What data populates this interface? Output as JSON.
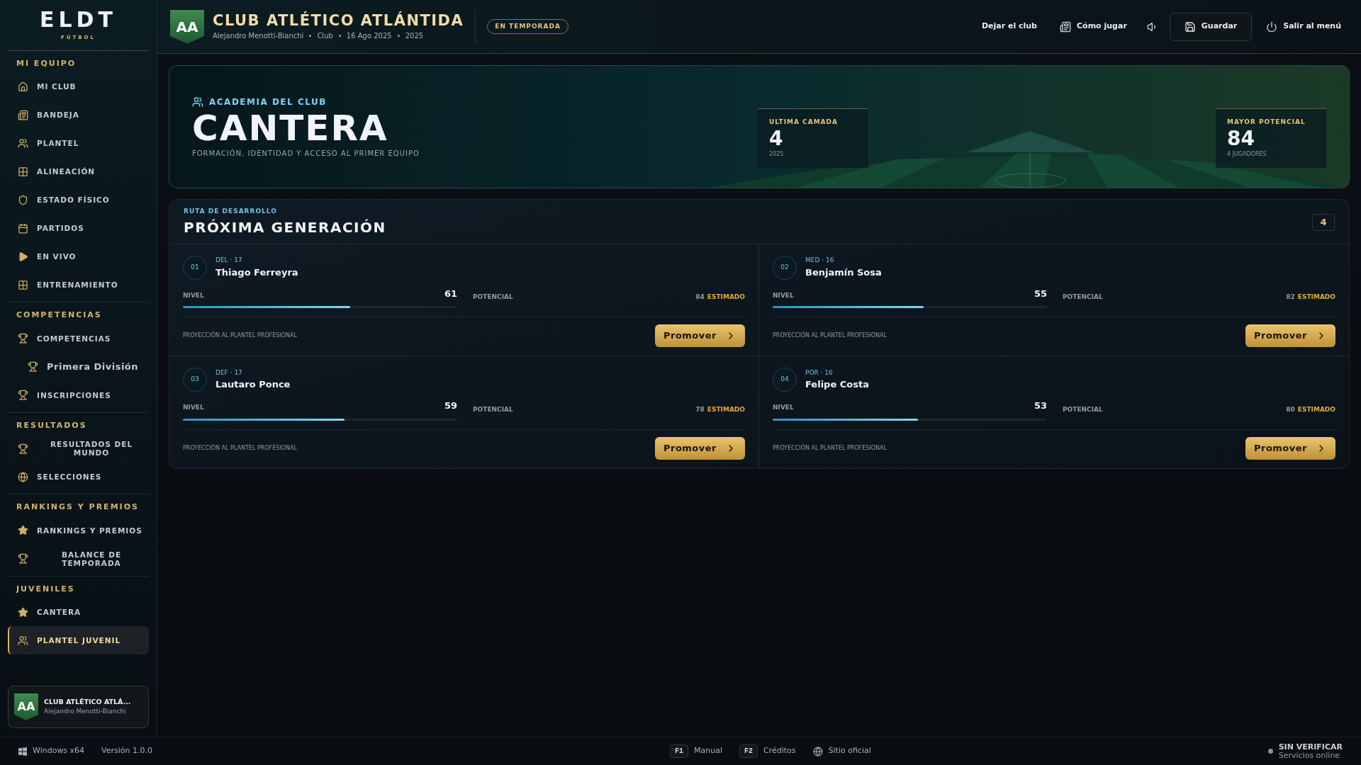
{
  "sidebar": {
    "logo": "ELDT",
    "logo_sub": "FÚTBOL",
    "groups": [
      {
        "title": "MI EQUIPO",
        "items": [
          {
            "label": "MI CLUB",
            "kind": "home",
            "selected": false
          },
          {
            "label": "BANDEJA",
            "kind": "inbox",
            "selected": false
          },
          {
            "label": "PLANTEL",
            "kind": "users",
            "selected": false
          },
          {
            "label": "ALINEACIÓN",
            "kind": "grid",
            "selected": false
          },
          {
            "label": "ESTADO FÍSICO",
            "kind": "shield",
            "selected": false
          },
          {
            "label": "PARTIDOS",
            "kind": "calendar",
            "selected": false
          },
          {
            "label": "EN VIVO",
            "kind": "play",
            "selected": false
          },
          {
            "label": "ENTRENAMIENTO",
            "kind": "grid",
            "selected": false
          }
        ]
      },
      {
        "title": "COMPETENCIAS",
        "items": [
          {
            "label": "COMPETENCIAS",
            "kind": "trophy",
            "selected": false,
            "children": [
              {
                "label": "Primera División",
                "kind": "trophy",
                "selected": false
              }
            ]
          },
          {
            "label": "INSCRIPCIONES",
            "kind": "trophy",
            "selected": false
          }
        ]
      },
      {
        "title": "RESULTADOS",
        "items": [
          {
            "label": "RESULTADOS DEL MUNDO",
            "kind": "trophy",
            "selected": false
          },
          {
            "label": "SELECCIONES",
            "kind": "globe",
            "selected": false
          }
        ]
      },
      {
        "title": "RANKINGS Y PREMIOS",
        "items": [
          {
            "label": "RANKINGS Y PREMIOS",
            "kind": "star",
            "selected": false
          },
          {
            "label": "BALANCE DE TEMPORADA",
            "kind": "trophy",
            "selected": false
          }
        ]
      },
      {
        "title": "JUVENILES",
        "items": [
          {
            "label": "CANTERA",
            "kind": "star",
            "selected": false
          },
          {
            "label": "PLANTEL JUVENIL",
            "kind": "users",
            "selected": true
          }
        ]
      }
    ],
    "club_card": {
      "badge": "AA",
      "name": "CLUB ATLÉTICO ATLÁ...",
      "manager": "Alejandro Menotti-Bianchi"
    }
  },
  "header": {
    "badge": "AA",
    "title": "CLUB ATLÉTICO ATLÁNTIDA",
    "meta": [
      "Alejandro Menotti-Bianchi",
      "Club",
      "16 Ago 2025",
      "2025"
    ],
    "status": "EN TEMPORADA",
    "actions": [
      {
        "kind": "leave",
        "label": "Dejar el club"
      },
      {
        "kind": "guide",
        "label": "Cómo jugar"
      },
      {
        "kind": "sound"
      },
      {
        "kind": "save",
        "label": "Guardar"
      },
      {
        "kind": "exit",
        "label": "Salir al menú"
      }
    ]
  },
  "hero": {
    "eyebrow": "ACADEMIA DEL CLUB",
    "title": "CANTERA",
    "subtitle": "FORMACIÓN, IDENTIDAD Y ACCESO AL PRIMER EQUIPO",
    "stats": [
      {
        "label": "ULTIMA CAMADA",
        "value": "4",
        "note": "2025"
      },
      {
        "label": "MAYOR POTENCIAL",
        "value": "84",
        "note": "4 JUGADORES"
      }
    ]
  },
  "generation": {
    "eyebrow": "RUTA DE DESARROLLO",
    "title": "PRÓXIMA GENERACIÓN",
    "count": "4",
    "players": [
      {
        "number": "01",
        "position": "DEL · 17",
        "name": "Thiago Ferreyra",
        "level_label": "NIVEL",
        "level_value": "61",
        "level": 0.61,
        "potential_label": "POTENCIAL",
        "potential": "84",
        "potential_note": "ESTIMADO",
        "projection": "PROYECCIÓN AL PLANTEL PROFESIONAL",
        "button": "Promover"
      },
      {
        "number": "02",
        "position": "MED · 16",
        "name": "Benjamín Sosa",
        "level_label": "NIVEL",
        "level_value": "55",
        "level": 0.55,
        "potential_label": "POTENCIAL",
        "potential": "82",
        "potential_note": "ESTIMADO",
        "projection": "PROYECCIÓN AL PLANTEL PROFESIONAL",
        "button": "Promover"
      },
      {
        "number": "03",
        "position": "DEF · 17",
        "name": "Lautaro Ponce",
        "level_label": "NIVEL",
        "level_value": "59",
        "level": 0.59,
        "potential_label": "POTENCIAL",
        "potential": "78",
        "potential_note": "ESTIMADO",
        "projection": "PROYECCIÓN AL PLANTEL PROFESIONAL",
        "button": "Promover"
      },
      {
        "number": "04",
        "position": "POR · 16",
        "name": "Felipe Costa",
        "level_label": "NIVEL",
        "level_value": "53",
        "level": 0.53,
        "potential_label": "POTENCIAL",
        "potential": "80",
        "potential_note": "ESTIMADO",
        "projection": "PROYECCIÓN AL PLANTEL PROFESIONAL",
        "button": "Promover"
      }
    ]
  },
  "footer": {
    "platform": "Windows x64",
    "version": "Versión 1.0.0",
    "links": [
      {
        "kind": "key",
        "key": "F1",
        "label": "Manual"
      },
      {
        "kind": "key",
        "key": "F2",
        "label": "Créditos"
      },
      {
        "kind": "web",
        "label": "Sitio oficial"
      }
    ],
    "status": {
      "online": false,
      "title": "SIN VERIFICAR",
      "subtitle": "Servicios online"
    }
  }
}
